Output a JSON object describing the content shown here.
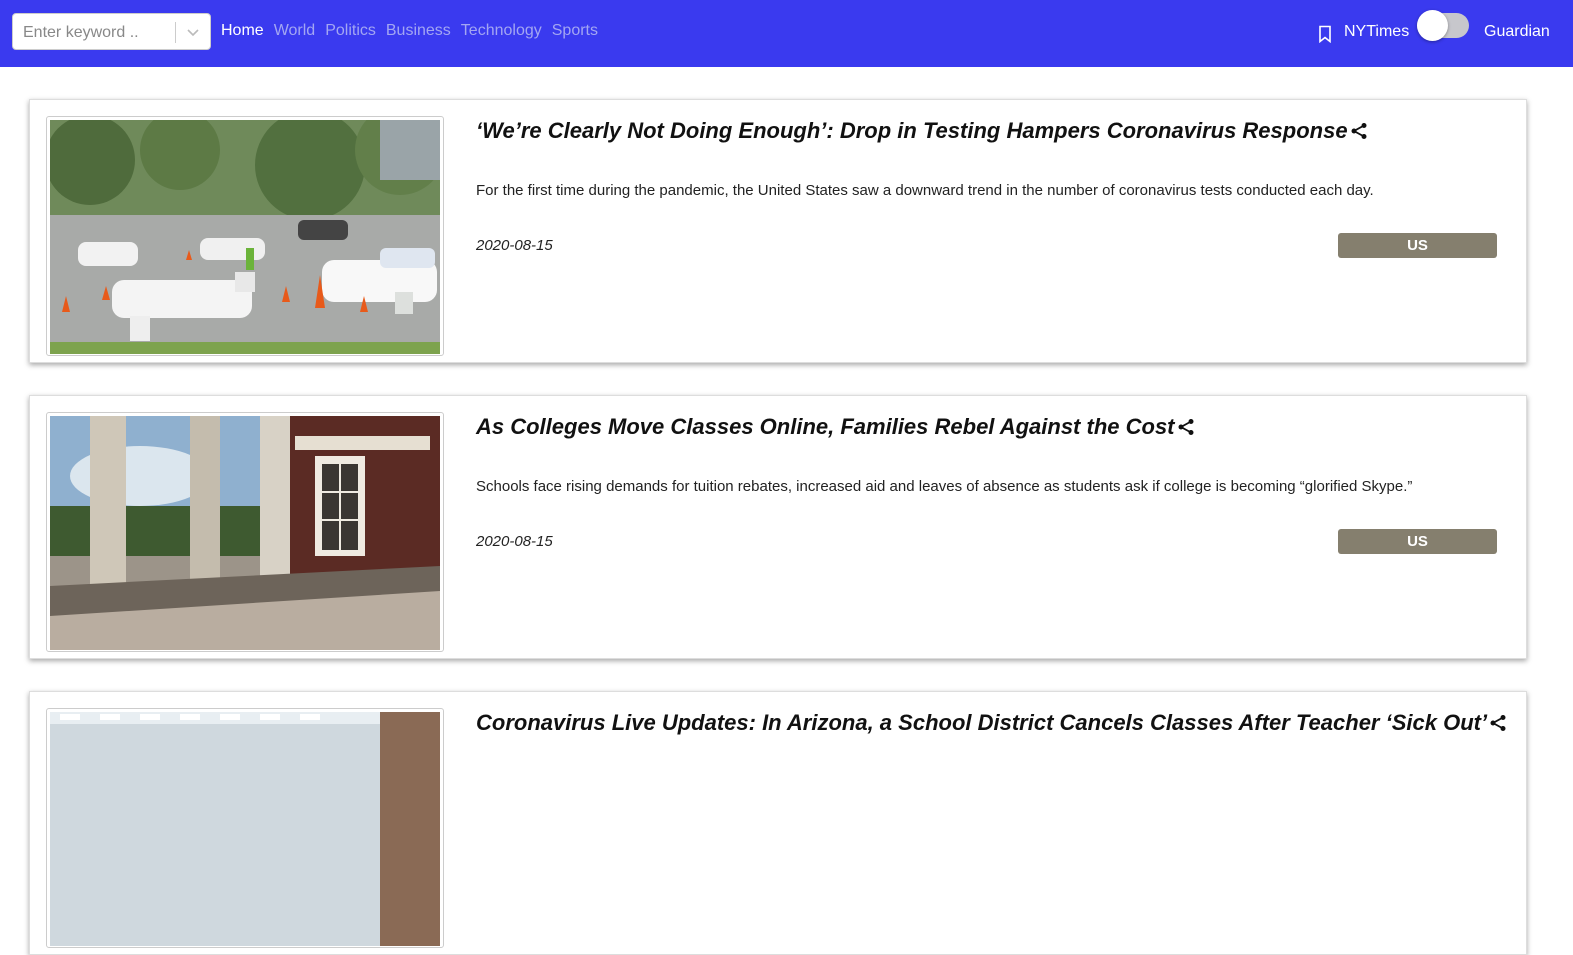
{
  "search": {
    "placeholder": "Enter keyword .."
  },
  "nav": {
    "links": [
      "Home",
      "World",
      "Politics",
      "Business",
      "Technology",
      "Sports"
    ],
    "active": "Home"
  },
  "source_toggle": {
    "left_label": "NYTimes",
    "right_label": "Guardian",
    "selected": "NYTimes"
  },
  "colors": {
    "navbar": "#3a3aef",
    "badge": "#857f6e",
    "nav_inactive": "#a3a6f2"
  },
  "articles": [
    {
      "title": "‘We’re Clearly Not Doing Enough’: Drop in Testing Hampers Coronavirus Response",
      "description": "For the first time during the pandemic, the United States saw a downward trend in the number of coronavirus tests conducted each day.",
      "date": "2020-08-15",
      "section": "US"
    },
    {
      "title": "As Colleges Move Classes Online, Families Rebel Against the Cost",
      "description": "Schools face rising demands for tuition rebates, increased aid and leaves of absence as students ask if college is becoming “glorified Skype.”",
      "date": "2020-08-15",
      "section": "US"
    },
    {
      "title": "Coronavirus Live Updates: In Arizona, a School District Cancels Classes After Teacher ‘Sick Out’",
      "description": "",
      "date": "",
      "section": ""
    }
  ]
}
